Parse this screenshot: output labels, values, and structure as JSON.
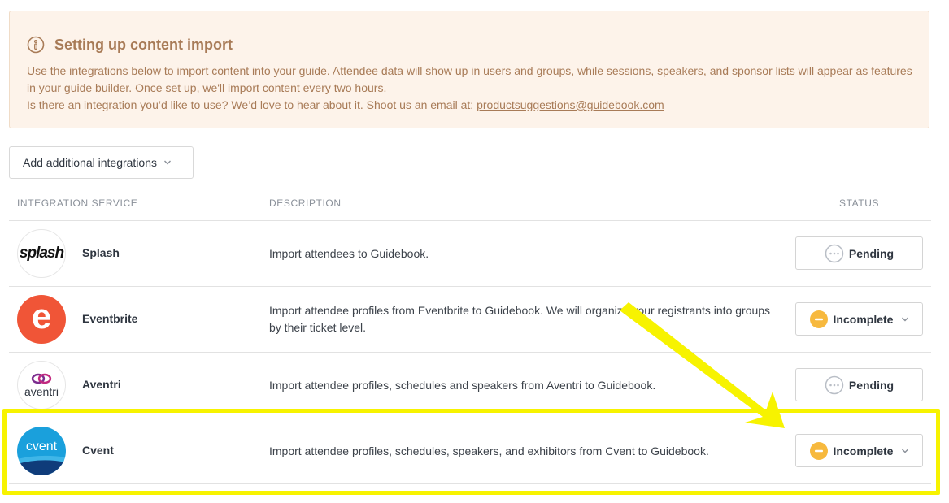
{
  "banner": {
    "title": "Setting up content import",
    "line1": "Use the integrations below to import content into your guide. Attendee data will show up in users and groups, while sessions, speakers, and sponsor lists will appear as features in your guide builder. Once set up, we'll import content every two hours.",
    "line2_prefix": "Is there an integration you’d like to use? We’d love to hear about it. Shoot us an email at: ",
    "email": "productsuggestions@guidebook.com"
  },
  "toolbar": {
    "add_label": "Add additional integrations"
  },
  "table": {
    "headers": {
      "service": "INTEGRATION SERVICE",
      "description": "DESCRIPTION",
      "status": "STATUS"
    },
    "rows": [
      {
        "logo_text": "splash",
        "name": "Splash",
        "description": "Import attendees to Guidebook.",
        "status": "Pending"
      },
      {
        "logo_text": "e",
        "name": "Eventbrite",
        "description": "Import attendee profiles from Eventbrite to Guidebook. We will organize your registrants into groups by their ticket level.",
        "status": "Incomplete"
      },
      {
        "logo_text": "aventri",
        "name": "Aventri",
        "description": "Import attendee profiles, schedules and speakers from Aventri to Guidebook.",
        "status": "Pending"
      },
      {
        "logo_text": "cvent",
        "name": "Cvent",
        "description": "Import attendee profiles, schedules, speakers, and exhibitors from Cvent to Guidebook.",
        "status": "Incomplete"
      }
    ]
  },
  "colors": {
    "banner_bg": "#fdf3ea",
    "banner_text": "#a87b57",
    "incomplete_icon": "#f7b93e",
    "highlight": "#f7f300",
    "eventbrite": "#f05537",
    "cvent": "#1aa0dc"
  }
}
